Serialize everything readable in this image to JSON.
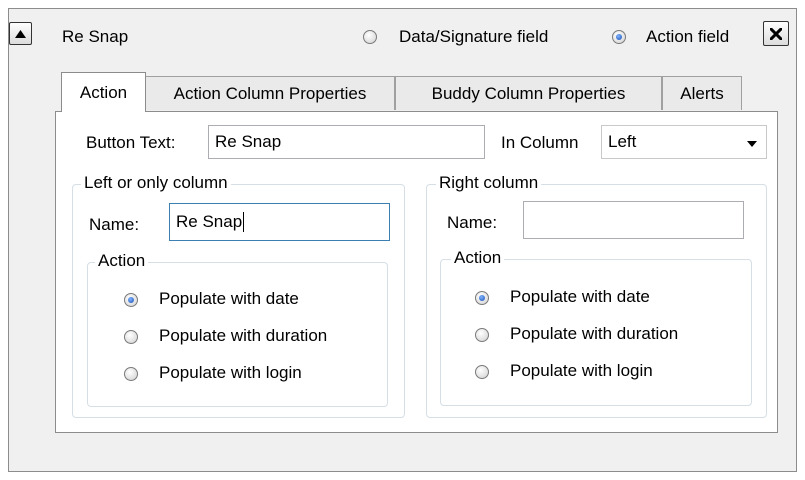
{
  "header": {
    "collapse_icon": "triangle-up-icon",
    "title": "Re Snap",
    "field_type_options": [
      {
        "label": "Data/Signature field",
        "selected": false
      },
      {
        "label": "Action field",
        "selected": true
      }
    ],
    "close_icon": "x-icon"
  },
  "tabs": [
    {
      "label": "Action",
      "active": true
    },
    {
      "label": "Action Column Properties",
      "active": false
    },
    {
      "label": "Buddy Column Properties",
      "active": false
    },
    {
      "label": "Alerts",
      "active": false
    }
  ],
  "action_tab": {
    "button_text_label": "Button Text:",
    "button_text_value": "Re Snap",
    "in_column_label": "In Column",
    "in_column_value": "Left",
    "left_group": {
      "title": "Left or only column",
      "name_label": "Name:",
      "name_value": "Re Snap",
      "action_group_title": "Action",
      "options": [
        {
          "label": "Populate with date",
          "selected": true
        },
        {
          "label": "Populate with duration",
          "selected": false
        },
        {
          "label": "Populate with login",
          "selected": false
        }
      ]
    },
    "right_group": {
      "title": "Right column",
      "name_label": "Name:",
      "name_value": "",
      "action_group_title": "Action",
      "options": [
        {
          "label": "Populate with date",
          "selected": true
        },
        {
          "label": "Populate with duration",
          "selected": false
        },
        {
          "label": "Populate with login",
          "selected": false
        }
      ]
    }
  },
  "colors": {
    "panel_bg": "#f0f0f0",
    "tab_page_bg": "#ffffff",
    "radio_selected": "#1c4fb3",
    "focus_border": "#3c7fb1"
  }
}
